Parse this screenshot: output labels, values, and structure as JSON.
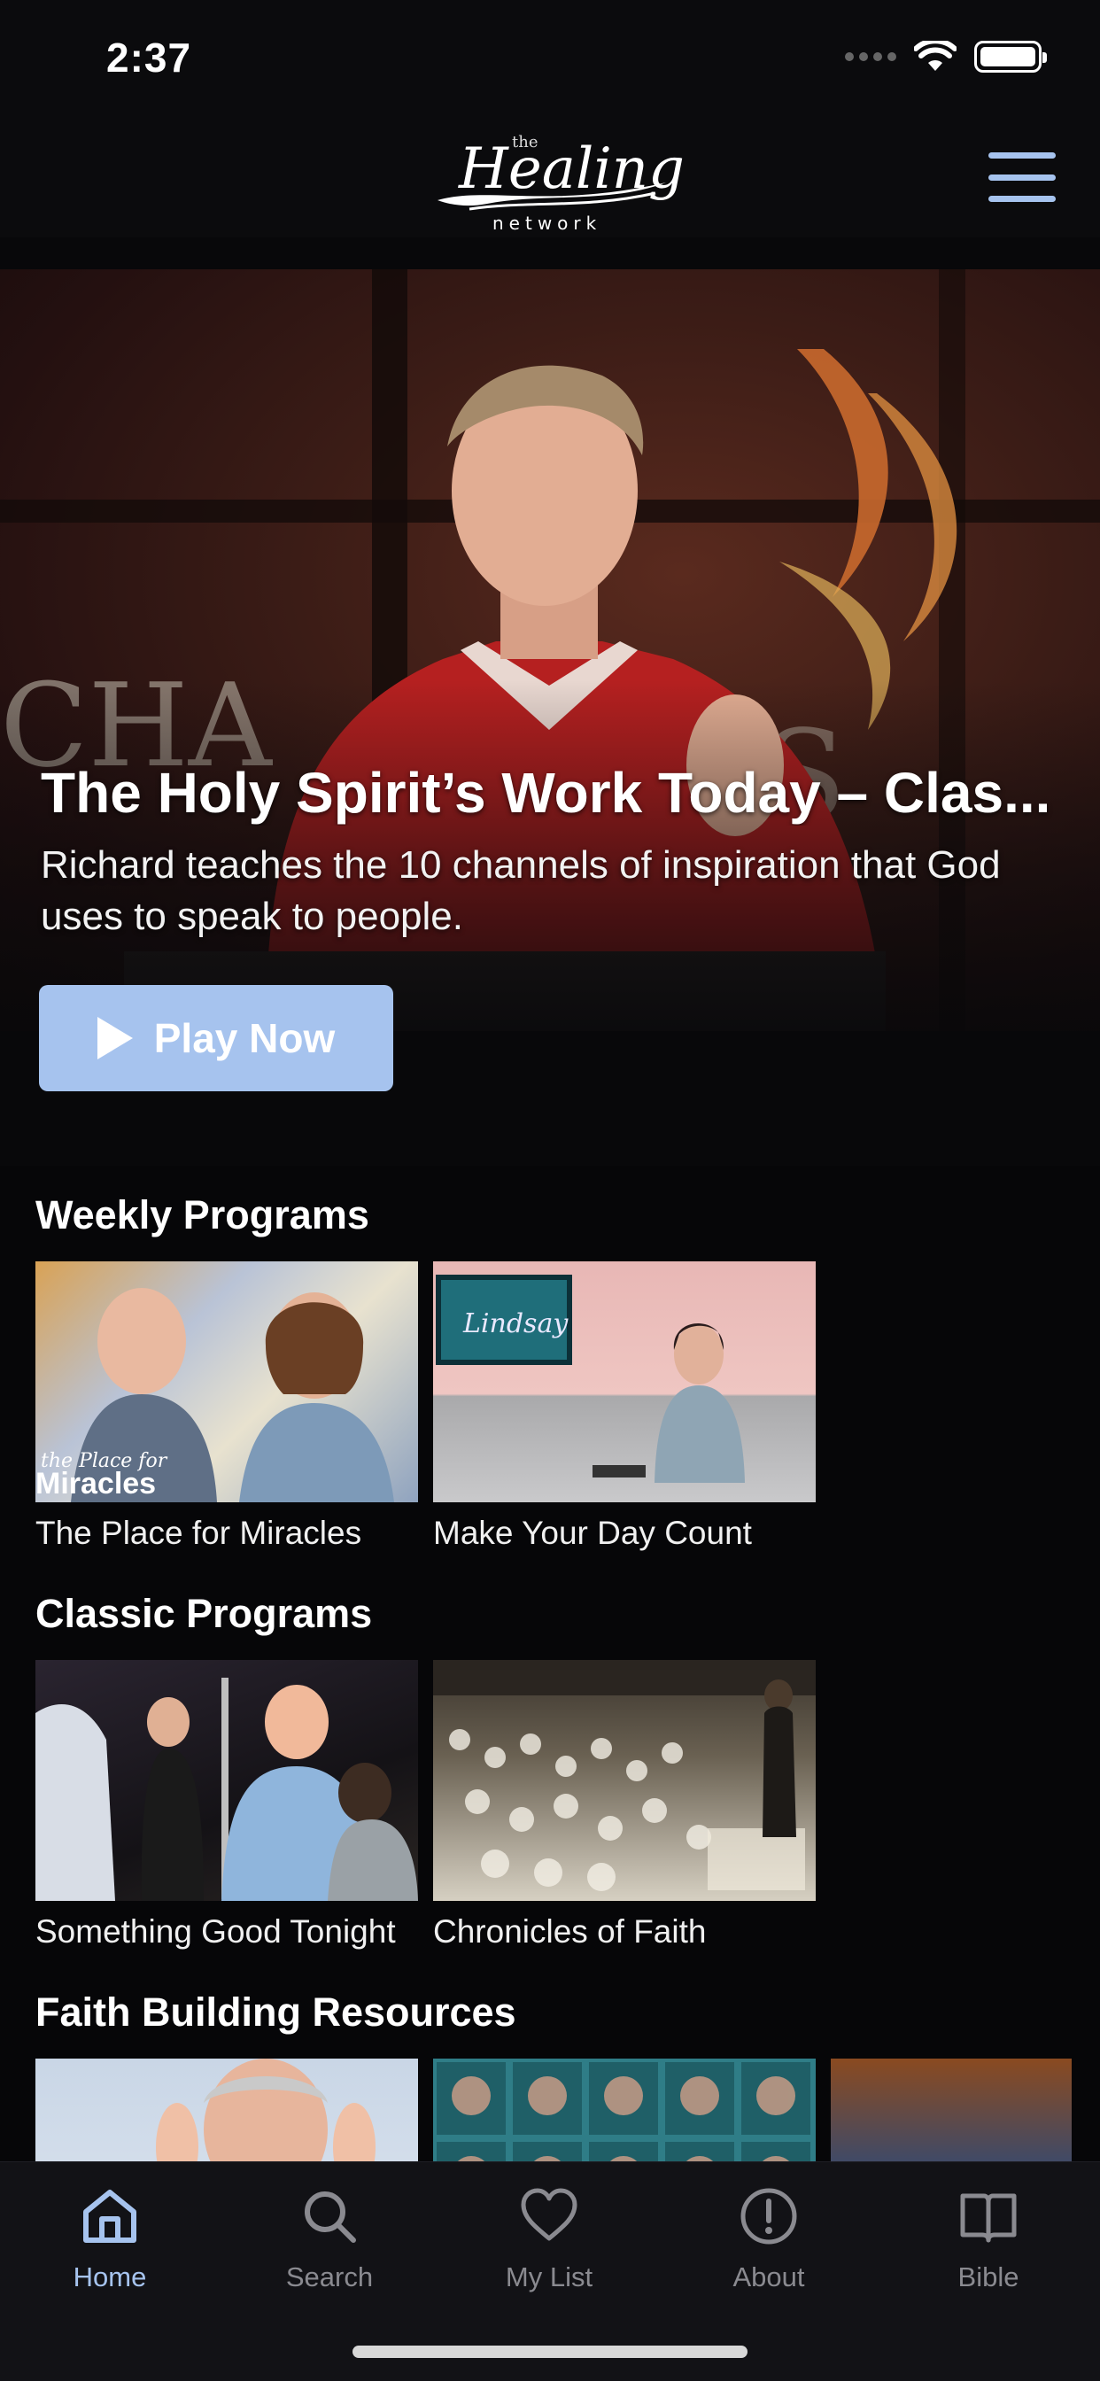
{
  "status_bar": {
    "time": "2:37"
  },
  "header": {
    "logo": {
      "the": "the",
      "name": "Healing",
      "sub": "network"
    }
  },
  "hero": {
    "title": "The Holy Spirit’s Work Today – Clas...",
    "description": "Richard teaches the 10 channels of inspiration that God uses to speak to people.",
    "play_label": "Play Now"
  },
  "sections": [
    {
      "title": "Weekly Programs",
      "items": [
        {
          "caption": "The Place for Miracles",
          "thumb_text": "Place for Miracles"
        },
        {
          "caption": "Make Your Day Count",
          "thumb_text": "Lindsay"
        }
      ]
    },
    {
      "title": "Classic Programs",
      "items": [
        {
          "caption": "Something Good Tonight"
        },
        {
          "caption": "Chronicles of Faith"
        }
      ]
    },
    {
      "title": "Faith Building Resources",
      "items": [
        {},
        {},
        {}
      ]
    }
  ],
  "tab_bar": {
    "items": [
      {
        "label": "Home",
        "icon": "home-icon",
        "active": true
      },
      {
        "label": "Search",
        "icon": "search-icon"
      },
      {
        "label": "My List",
        "icon": "heart-icon"
      },
      {
        "label": "About",
        "icon": "info-icon"
      },
      {
        "label": "Bible",
        "icon": "book-icon"
      }
    ]
  },
  "colors": {
    "accent": "#a6c3ee",
    "background": "#060608",
    "tab_inactive": "#8a8a90"
  }
}
